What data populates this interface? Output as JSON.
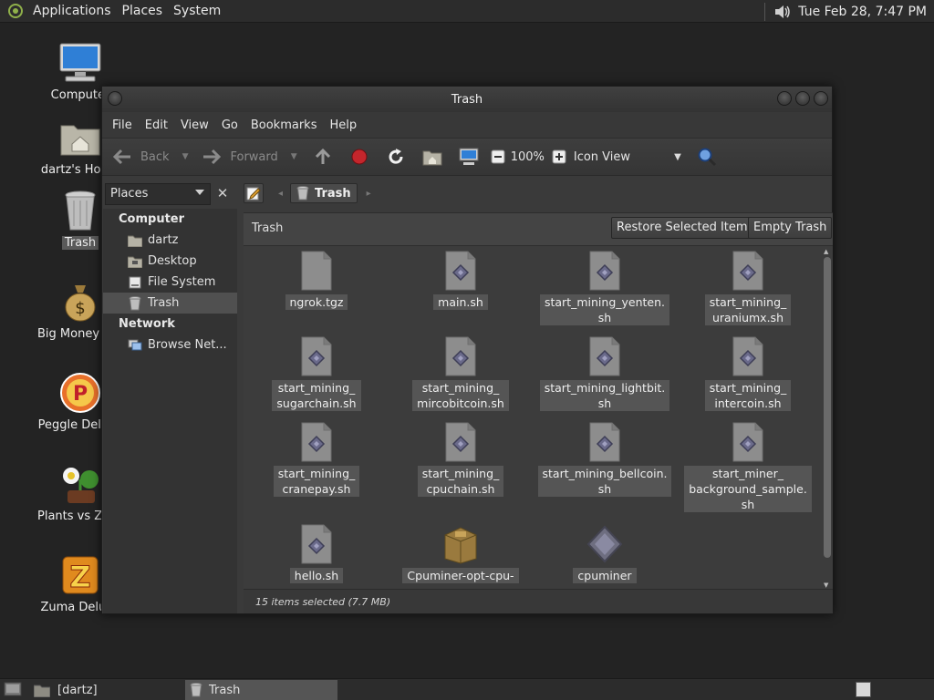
{
  "top_panel": {
    "menus": [
      "Applications",
      "Places",
      "System"
    ],
    "clock": "Tue Feb 28,  7:47 PM"
  },
  "desktop_icons": [
    {
      "label": "Computer",
      "icon": "computer-icon"
    },
    {
      "label": "dartz's Home",
      "icon": "home-folder-icon"
    },
    {
      "label": "Trash",
      "icon": "trash-icon",
      "selected": true
    },
    {
      "label": "Big Money Deluxe",
      "icon": "money-bag-icon"
    },
    {
      "label": "Peggle Deluxe",
      "icon": "peggle-icon"
    },
    {
      "label": "Plants vs Zombies",
      "icon": "plants-icon"
    },
    {
      "label": "Zuma Deluxe",
      "icon": "zuma-icon"
    }
  ],
  "window": {
    "title": "Trash",
    "menu": [
      "File",
      "Edit",
      "View",
      "Go",
      "Bookmarks",
      "Help"
    ],
    "toolbar": {
      "back": "Back",
      "forward": "Forward",
      "zoom": "100%",
      "view_mode": "Icon View"
    },
    "sidebar_select": "Places",
    "breadcrumb": "Trash",
    "sidebar": {
      "computer_header": "Computer",
      "computer_items": [
        "dartz",
        "Desktop",
        "File System",
        "Trash"
      ],
      "network_header": "Network",
      "network_items": [
        "Browse Net..."
      ]
    },
    "location_label": "Trash",
    "restore_button": "Restore Selected Items",
    "empty_button": "Empty Trash",
    "files": [
      {
        "name": "ngrok.tgz",
        "kind": "archive"
      },
      {
        "name": "main.sh",
        "kind": "script"
      },
      {
        "name": "start_mining_yenten.\nsh",
        "kind": "script"
      },
      {
        "name": "start_mining_\nuraniumx.sh",
        "kind": "script"
      },
      {
        "name": "start_mining_\nsugarchain.sh",
        "kind": "script"
      },
      {
        "name": "start_mining_\nmircobitcoin.sh",
        "kind": "script"
      },
      {
        "name": "start_mining_lightbit.\nsh",
        "kind": "script"
      },
      {
        "name": "start_mining_\nintercoin.sh",
        "kind": "script"
      },
      {
        "name": "start_mining_\ncranepay.sh",
        "kind": "script"
      },
      {
        "name": "start_mining_\ncpuchain.sh",
        "kind": "script"
      },
      {
        "name": "start_mining_bellcoin.\nsh",
        "kind": "script"
      },
      {
        "name": "start_miner_\nbackground_sample.\nsh",
        "kind": "script"
      },
      {
        "name": "hello.sh",
        "kind": "script"
      },
      {
        "name": "Cpuminer-opt-cpu-",
        "kind": "package"
      },
      {
        "name": "cpuminer",
        "kind": "binary"
      }
    ],
    "status": "15 items selected (7.7 MB)"
  },
  "bottom_panel": {
    "tasks": [
      "[dartz]",
      "Trash"
    ]
  }
}
